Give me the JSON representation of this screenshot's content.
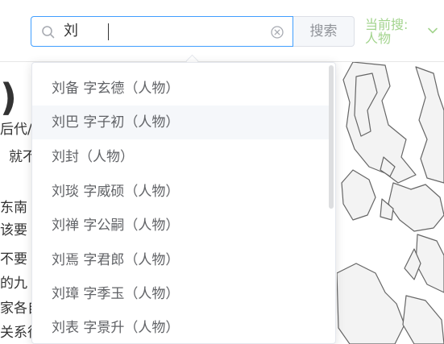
{
  "search": {
    "value": "刘",
    "button_label": "搜索",
    "current_label": "当前搜: 人物"
  },
  "suggestions": [
    "刘备 字玄德（人物）",
    "刘巴 字子初（人物）",
    "刘封（人物）",
    "刘琰 字威硕（人物）",
    "刘禅 字公嗣（人物）",
    "刘焉 字君郎（人物）",
    "刘璋 字季玉（人物）",
    "刘表 字景升（人物）"
  ],
  "background_text": {
    "paren": ")",
    "lines": [
      "后代/",
      "就不",
      "东南",
      "该要",
      "不要",
      "的九",
      "家各自",
      "关系很"
    ]
  },
  "colors": {
    "accent": "#409eff",
    "current_label": "#a3d48e",
    "hover_bg": "#f5f7fa"
  }
}
